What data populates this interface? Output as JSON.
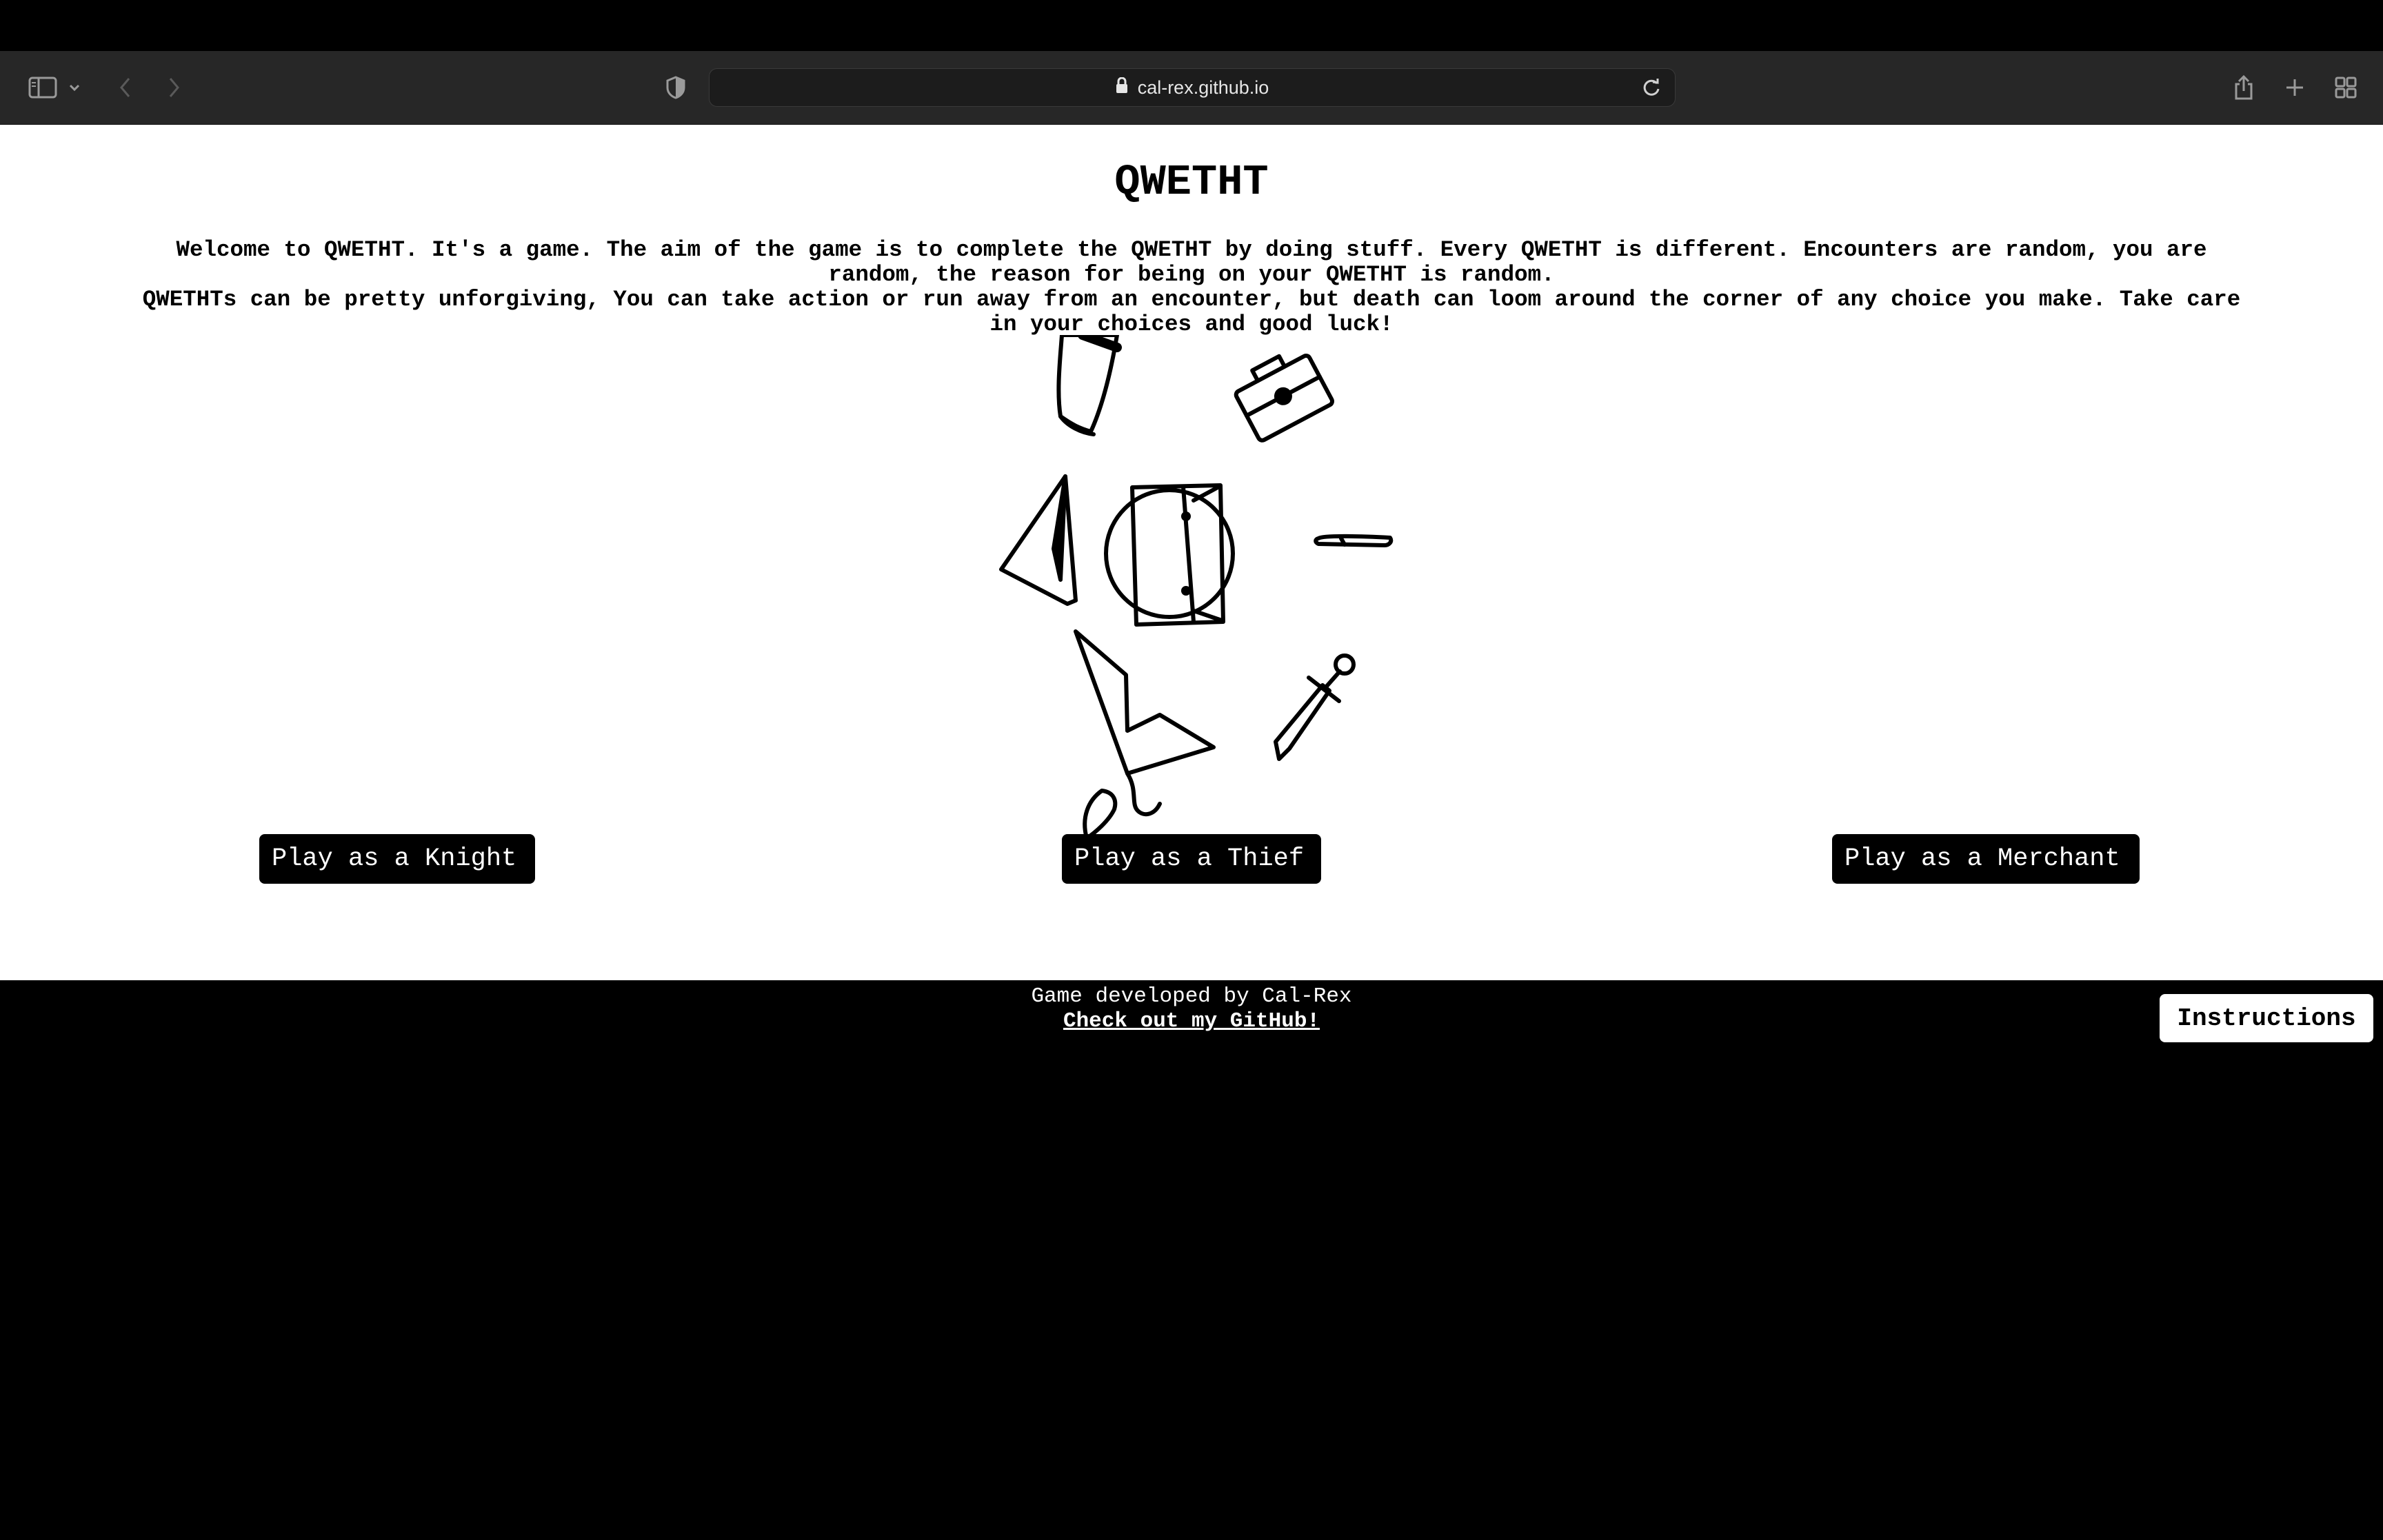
{
  "browser": {
    "url": "cal-rex.github.io"
  },
  "page": {
    "title": "QWETHT",
    "intro_line1": "Welcome to QWETHT. It's a game. The aim of the game is to complete the QWETHT by doing stuff. Every QWETHT is different. Encounters are random, you are random, the reason for being on your QWETHT is random.",
    "intro_line2": "QWETHTs can be pretty unforgiving, You can take action or run away from an encounter, but death can loom around the corner of any choice you make. Take care in your choices and good luck!",
    "buttons": {
      "knight": "Play as a Knight",
      "thief": "Play as a Thief",
      "merchant": "Play as a Merchant"
    }
  },
  "footer": {
    "credit": "Game developed by Cal-Rex",
    "github_link": "Check out my GitHub!",
    "instructions": "Instructions"
  },
  "icons": [
    "sidebar-icon",
    "chevron-down-icon",
    "back-arrow-icon",
    "forward-arrow-icon",
    "shield-privacy-icon",
    "lock-icon",
    "reload-icon",
    "share-icon",
    "new-tab-plus-icon",
    "tab-overview-icon",
    "top-hat-icon",
    "briefcase-icon",
    "wizard-hat-icon",
    "shield-icon",
    "knife-icon",
    "boot-icon",
    "sword-icon",
    "feather-quill-icon"
  ],
  "colors": {
    "page_bg": "#ffffff",
    "footer_bg": "#000000",
    "button_bg": "#000000",
    "toolbar_bg": "#272727"
  }
}
